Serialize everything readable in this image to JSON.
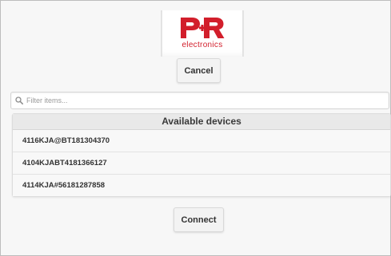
{
  "branding": {
    "logo_text": "PR",
    "logo_subtext": "electronics",
    "brand_color": "#d21e2b"
  },
  "actions": {
    "cancel_label": "Cancel",
    "connect_label": "Connect"
  },
  "search": {
    "placeholder": "Filter items...",
    "value": "",
    "icon": "search-icon"
  },
  "device_list": {
    "title": "Available devices",
    "items": [
      {
        "label": "4116KJA@BT181304370"
      },
      {
        "label": "4104KJABT4181366127"
      },
      {
        "label": "4114KJA#56181287858"
      }
    ]
  }
}
